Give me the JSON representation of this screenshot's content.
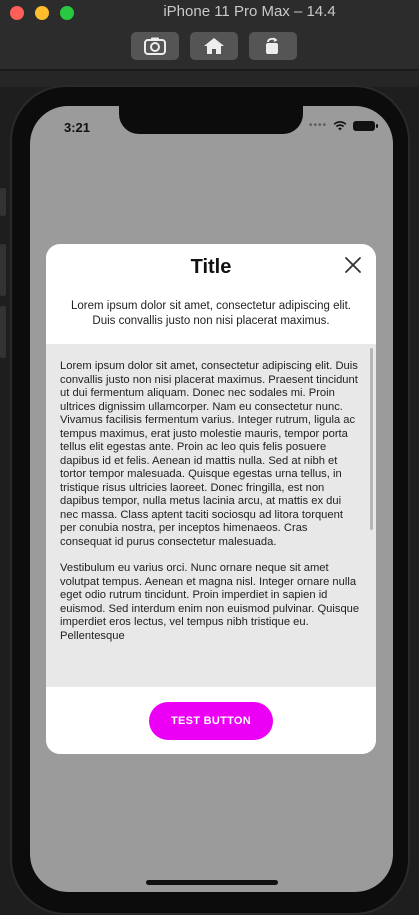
{
  "simulator": {
    "title": "iPhone 11 Pro Max – 14.4",
    "toolbar": [
      {
        "icon": "screenshot-icon"
      },
      {
        "icon": "home-icon"
      },
      {
        "icon": "rotate-icon"
      }
    ]
  },
  "status_bar": {
    "time": "3:21",
    "signal": "••••"
  },
  "dialog": {
    "title": "Title",
    "subtitle": "Lorem ipsum dolor sit amet, consectetur adipiscing elit. Duis convallis justo non nisi placerat maximus.",
    "body": [
      "Lorem ipsum dolor sit amet, consectetur adipiscing elit. Duis convallis justo non nisi placerat maximus. Praesent tincidunt ut dui fermentum aliquam. Donec nec sodales mi. Proin ultrices dignissim ullamcorper. Nam eu consectetur nunc. Vivamus facilisis fermentum varius. Integer rutrum, ligula ac tempus maximus, erat justo molestie mauris, tempor porta tellus elit egestas ante. Proin ac leo quis felis posuere dapibus id et felis. Aenean id mattis nulla. Sed at nibh et tortor tempor malesuada. Quisque egestas urna tellus, in tristique risus ultricies laoreet. Donec fringilla, est non dapibus tempor, nulla metus lacinia arcu, at mattis ex dui nec massa. Class aptent taciti sociosqu ad litora torquent per conubia nostra, per inceptos himenaeos. Cras consequat id purus consectetur malesuada.",
      "Vestibulum eu varius orci. Nunc ornare neque sit amet volutpat tempus. Aenean et magna nisl. Integer ornare nulla eget odio rutrum tincidunt. Proin imperdiet in sapien id euismod. Sed interdum enim non euismod pulvinar. Quisque imperdiet eros lectus, vel tempus nibh tristique eu. Pellentesque"
    ],
    "button_label": "TEST BUTTON",
    "button_color": "#ec00f5"
  }
}
